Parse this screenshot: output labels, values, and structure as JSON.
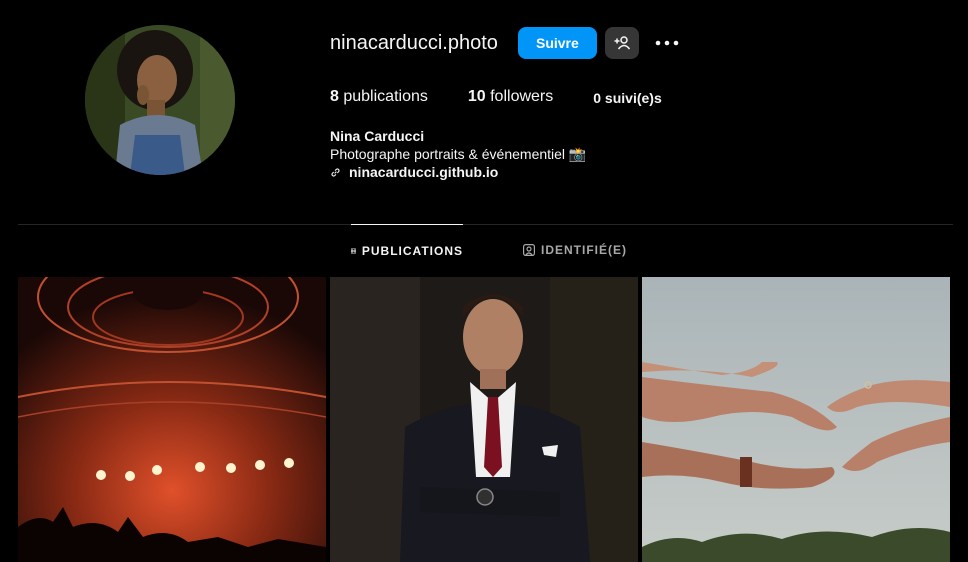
{
  "profile": {
    "username": "ninacarducci.photo",
    "follow_label": "Suivre",
    "stats": {
      "posts_count": "8",
      "posts_label": "publications",
      "followers_count": "10",
      "followers_label": "followers",
      "following_text": "0 suivi(e)s"
    },
    "bio": {
      "name": "Nina Carducci",
      "description": "Photographe portraits & événementiel 📸",
      "link": "ninacarducci.github.io"
    }
  },
  "tabs": [
    {
      "label": "PUBLICATIONS",
      "active": true,
      "icon": "grid-icon"
    },
    {
      "label": "IDENTIFIÉ(E)",
      "active": false,
      "icon": "tagged-icon"
    }
  ],
  "posts": [
    {
      "subject": "concert-stage"
    },
    {
      "subject": "man-in-suit-portrait"
    },
    {
      "subject": "hands-reaching"
    }
  ],
  "colors": {
    "accent": "#0095f6",
    "background": "#000000",
    "secondary_button": "#363636"
  }
}
